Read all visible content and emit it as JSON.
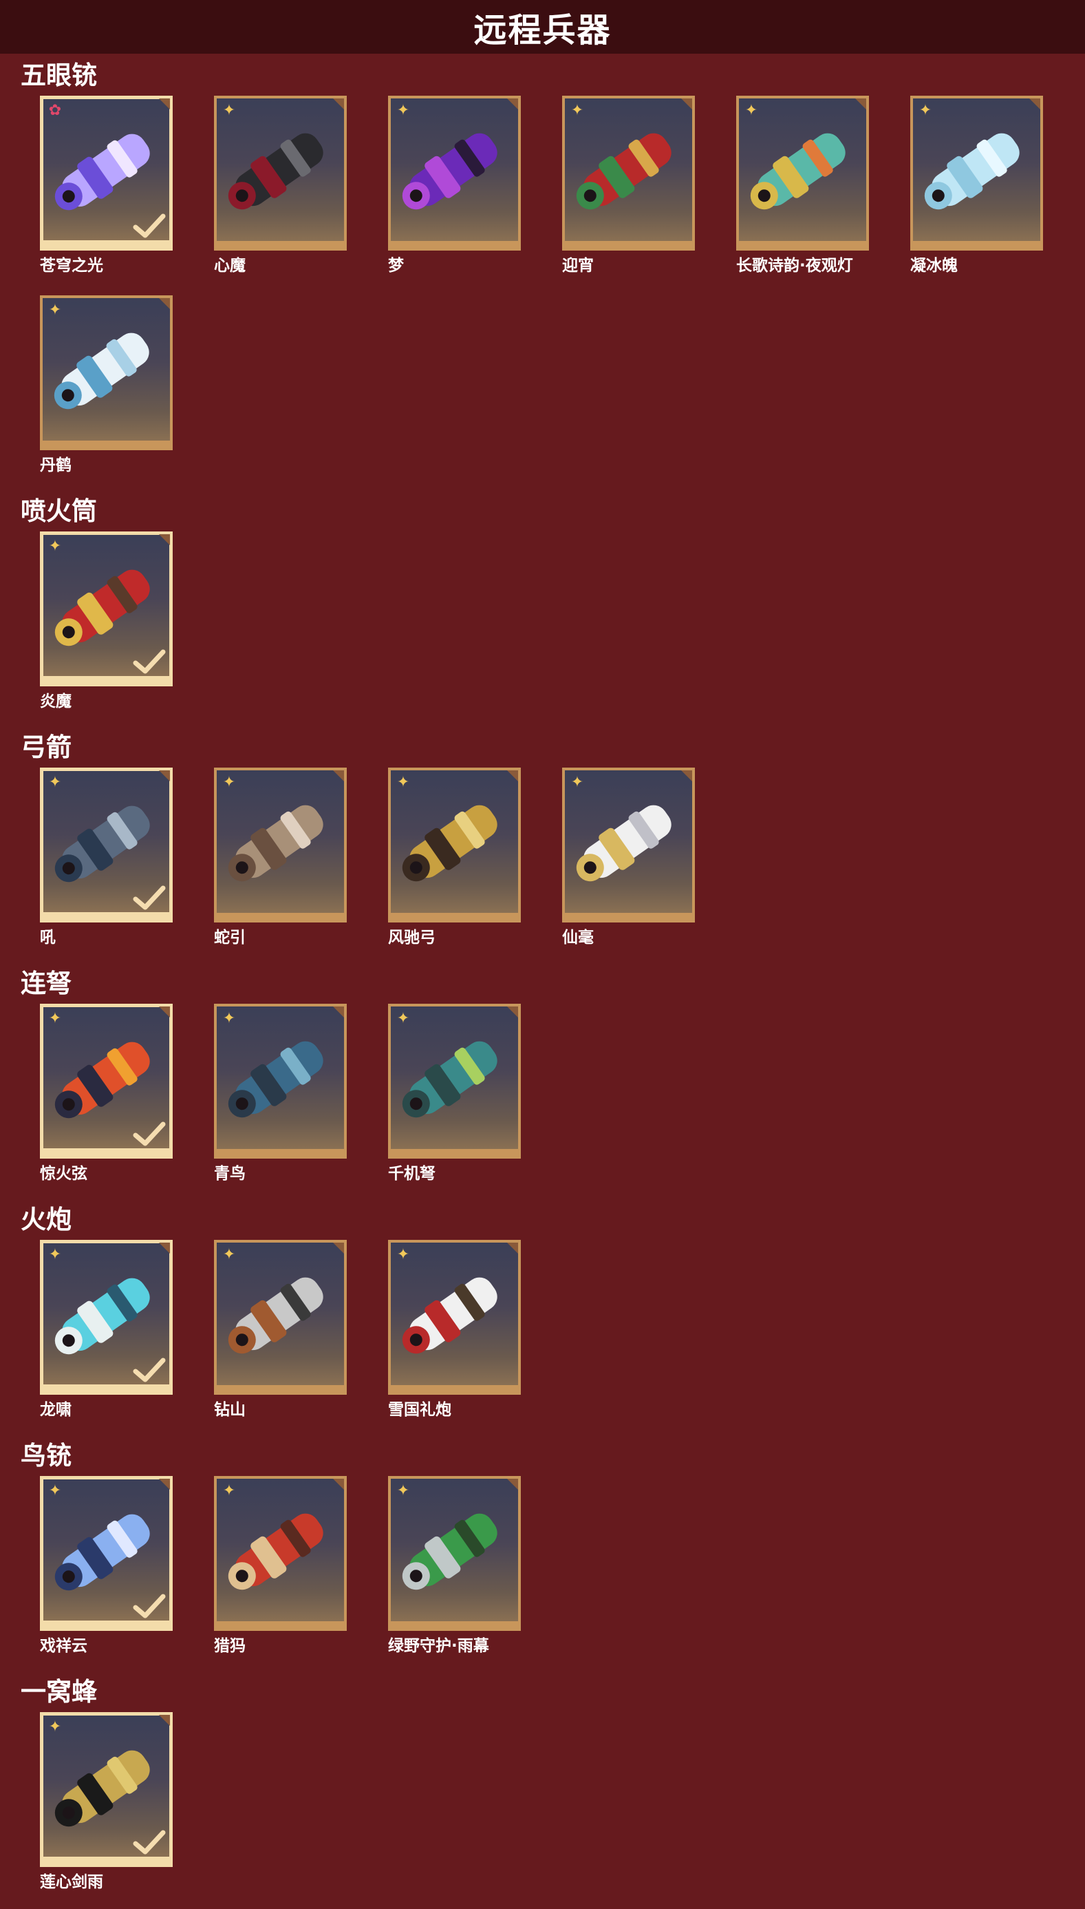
{
  "header": {
    "title": "远程兵器"
  },
  "categories": [
    {
      "title": "五眼铳",
      "items": [
        {
          "name": "苍穹之光",
          "selected": true,
          "rarity": "red",
          "art": "purple-blue"
        },
        {
          "name": "心魔",
          "selected": false,
          "rarity": "gold",
          "art": "dark-red"
        },
        {
          "name": "梦",
          "selected": false,
          "rarity": "gold",
          "art": "purple"
        },
        {
          "name": "迎宵",
          "selected": false,
          "rarity": "gold",
          "art": "red-green"
        },
        {
          "name": "长歌诗韵·夜观灯",
          "selected": false,
          "rarity": "gold",
          "art": "teal-gold"
        },
        {
          "name": "凝冰魄",
          "selected": false,
          "rarity": "gold",
          "art": "ice"
        },
        {
          "name": "丹鹤",
          "selected": false,
          "rarity": "gold",
          "art": "white-blue"
        }
      ]
    },
    {
      "title": "喷火筒",
      "items": [
        {
          "name": "炎魔",
          "selected": true,
          "rarity": "gold",
          "art": "red-gold"
        }
      ]
    },
    {
      "title": "弓箭",
      "items": [
        {
          "name": "吼",
          "selected": true,
          "rarity": "gold",
          "art": "blue-gray"
        },
        {
          "name": "蛇引",
          "selected": false,
          "rarity": "gold",
          "art": "bone"
        },
        {
          "name": "风驰弓",
          "selected": false,
          "rarity": "gold",
          "art": "gold-dark"
        },
        {
          "name": "仙毫",
          "selected": false,
          "rarity": "gold",
          "art": "white-gold"
        }
      ]
    },
    {
      "title": "连弩",
      "items": [
        {
          "name": "惊火弦",
          "selected": true,
          "rarity": "gold",
          "art": "fire"
        },
        {
          "name": "青鸟",
          "selected": false,
          "rarity": "gold",
          "art": "blue-steel"
        },
        {
          "name": "千机弩",
          "selected": false,
          "rarity": "gold",
          "art": "teal"
        }
      ]
    },
    {
      "title": "火炮",
      "items": [
        {
          "name": "龙啸",
          "selected": true,
          "rarity": "gold",
          "art": "cyan-dragon"
        },
        {
          "name": "钻山",
          "selected": false,
          "rarity": "gold",
          "art": "silver"
        },
        {
          "name": "雪国礼炮",
          "selected": false,
          "rarity": "gold",
          "art": "white-red"
        }
      ]
    },
    {
      "title": "鸟铳",
      "items": [
        {
          "name": "戏祥云",
          "selected": true,
          "rarity": "gold",
          "art": "blue-spear"
        },
        {
          "name": "猎犸",
          "selected": false,
          "rarity": "gold",
          "art": "red-spear"
        },
        {
          "name": "绿野守护·雨幕",
          "selected": false,
          "rarity": "gold",
          "art": "green-spear"
        }
      ]
    },
    {
      "title": "一窝蜂",
      "items": [
        {
          "name": "莲心剑雨",
          "selected": true,
          "rarity": "gold",
          "art": "gold-black"
        }
      ]
    }
  ],
  "colors": {
    "background": "#661a1e",
    "header": "#3b0d10",
    "frame": "#c8965b",
    "frame_selected": "#f3dcaa",
    "rarity_gold": "#f1c85a",
    "rarity_red": "#e0476a"
  }
}
